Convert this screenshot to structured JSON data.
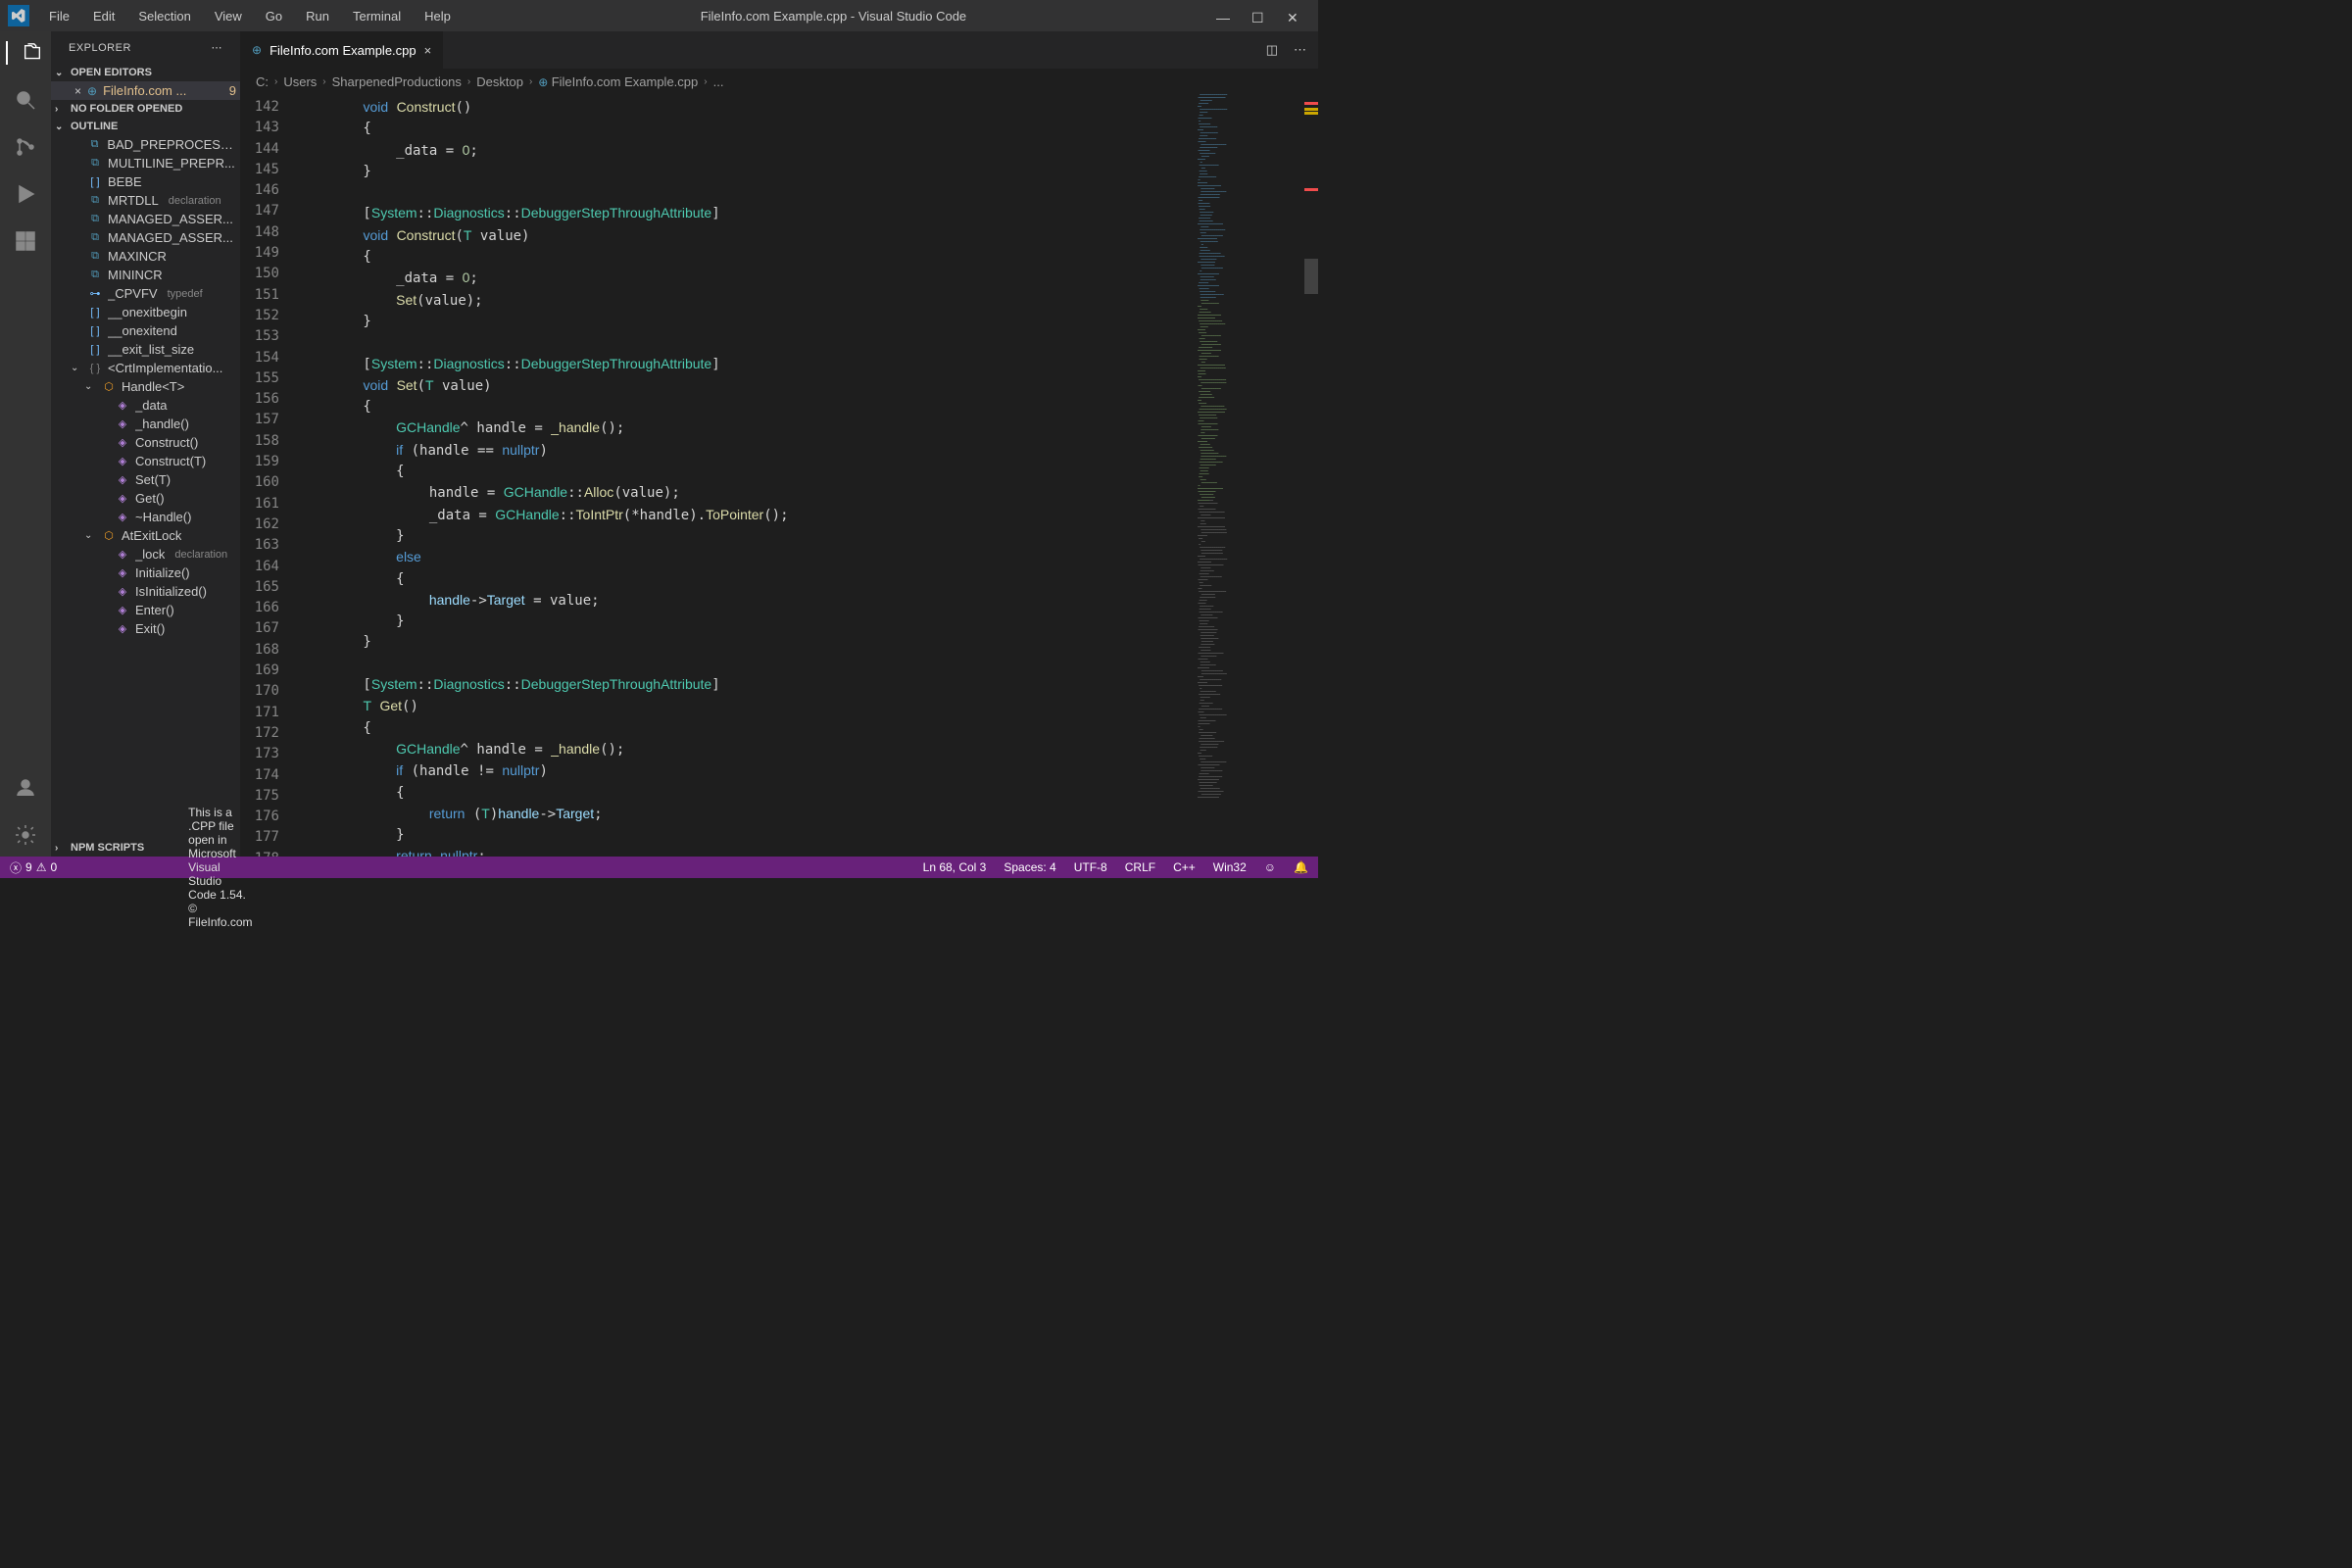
{
  "window": {
    "title": "FileInfo.com Example.cpp - Visual Studio Code"
  },
  "menu": [
    "File",
    "Edit",
    "Selection",
    "View",
    "Go",
    "Run",
    "Terminal",
    "Help"
  ],
  "sidebar": {
    "title": "EXPLORER",
    "sections": {
      "open_editors": "OPEN EDITORS",
      "no_folder": "NO FOLDER OPENED",
      "outline": "OUTLINE",
      "npm": "NPM SCRIPTS"
    },
    "open_file": "FileInfo.com ...",
    "badge": "9",
    "outline": [
      {
        "icon": "def",
        "label": "BAD_PREPROCESS...",
        "ind": 0
      },
      {
        "icon": "def",
        "label": "MULTILINE_PREPR...",
        "ind": 0
      },
      {
        "icon": "var",
        "label": "BEBE",
        "ind": 0
      },
      {
        "icon": "def",
        "label": "MRTDLL",
        "decl": "declaration",
        "ind": 0
      },
      {
        "icon": "def",
        "label": "MANAGED_ASSER...",
        "ind": 0
      },
      {
        "icon": "def",
        "label": "MANAGED_ASSER...",
        "ind": 0
      },
      {
        "icon": "def",
        "label": "MAXINCR",
        "ind": 0
      },
      {
        "icon": "def",
        "label": "MININCR",
        "ind": 0
      },
      {
        "icon": "typedef",
        "label": "_CPVFV",
        "decl": "typedef",
        "ind": 0
      },
      {
        "icon": "var",
        "label": "__onexitbegin",
        "ind": 0
      },
      {
        "icon": "var",
        "label": "__onexitend",
        "ind": 0
      },
      {
        "icon": "var",
        "label": "__exit_list_size",
        "ind": 0
      },
      {
        "icon": "ns",
        "label": "<CrtImplementatio...",
        "ind": 0,
        "chev": "v"
      },
      {
        "icon": "class",
        "label": "Handle<T>",
        "ind": 1,
        "chev": "v"
      },
      {
        "icon": "meth",
        "label": "_data",
        "ind": 2
      },
      {
        "icon": "meth",
        "label": "_handle()",
        "ind": 2
      },
      {
        "icon": "meth",
        "label": "Construct()",
        "ind": 2
      },
      {
        "icon": "meth",
        "label": "Construct(T)",
        "ind": 2
      },
      {
        "icon": "meth",
        "label": "Set(T)",
        "ind": 2
      },
      {
        "icon": "meth",
        "label": "Get()",
        "ind": 2
      },
      {
        "icon": "meth",
        "label": "~Handle()",
        "ind": 2
      },
      {
        "icon": "class",
        "label": "AtExitLock",
        "ind": 1,
        "chev": "v"
      },
      {
        "icon": "meth",
        "label": "_lock",
        "decl": "declaration",
        "ind": 2
      },
      {
        "icon": "meth",
        "label": "Initialize()",
        "ind": 2
      },
      {
        "icon": "meth",
        "label": "IsInitialized()",
        "ind": 2
      },
      {
        "icon": "meth",
        "label": "Enter()",
        "ind": 2
      },
      {
        "icon": "meth",
        "label": "Exit()",
        "ind": 2
      }
    ]
  },
  "tab": {
    "name": "FileInfo.com Example.cpp"
  },
  "breadcrumb": [
    "C:",
    "Users",
    "SharpenedProductions",
    "Desktop",
    "FileInfo.com Example.cpp",
    "..."
  ],
  "gutter_start": 142,
  "gutter_end": 178,
  "status": {
    "errors": "9",
    "warnings": "0",
    "msg": "This is a .CPP file open in Microsoft Visual Studio Code 1.54. © FileInfo.com",
    "right": [
      "Ln 68, Col 3",
      "Spaces: 4",
      "UTF-8",
      "CRLF",
      "C++",
      "Win32"
    ]
  }
}
